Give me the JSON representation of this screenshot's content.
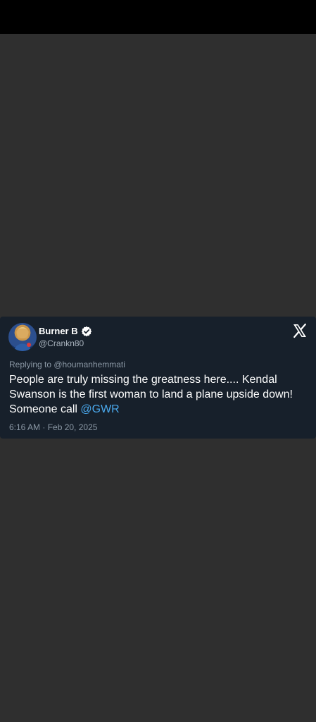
{
  "tweet": {
    "display_name": "Burner B",
    "handle": "@Crankn80",
    "replying_to": "Replying to @houmanhemmati",
    "text_line_1": "People are truly missing the greatness here.... Kendal",
    "text_line_2": "Swanson is the first woman to land a plane upside down!",
    "text_line_3_prefix": "Someone call ",
    "mention": "@GWR",
    "timestamp": "6:16 AM · Feb 20, 2025"
  },
  "icons": {
    "verified": "verified-badge-icon",
    "platform": "x-logo-icon",
    "avatar": "avatar"
  },
  "colors": {
    "page_background": "#2f2f2f",
    "top_bar": "#000000",
    "card_background": "#17202b",
    "mention": "#4aa8ec",
    "secondary_text": "#8b98a5"
  }
}
